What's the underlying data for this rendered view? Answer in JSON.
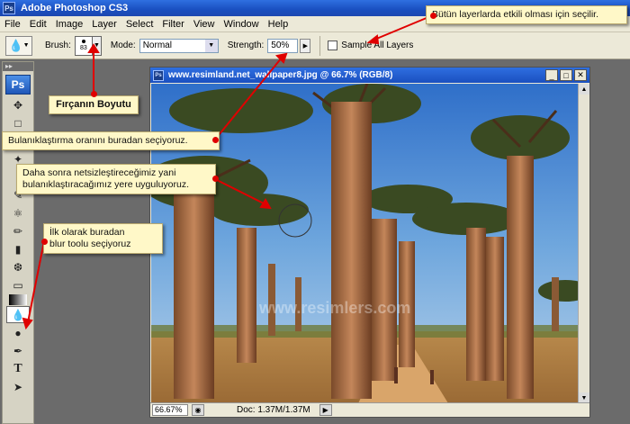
{
  "app": {
    "title": "Adobe Photoshop CS3",
    "logo_letters": "Ps"
  },
  "menu": [
    "File",
    "Edit",
    "Image",
    "Layer",
    "Select",
    "Filter",
    "View",
    "Window",
    "Help"
  ],
  "options": {
    "brush_label": "Brush:",
    "brush_size": "83",
    "mode_label": "Mode:",
    "mode_value": "Normal",
    "strength_label": "Strength:",
    "strength_value": "50%",
    "sample_all_layers_label": "Sample All Layers"
  },
  "document": {
    "title": "www.resimland.net_wallpaper8.jpg @ 66.7% (RGB/8)",
    "zoom": "66.67%",
    "doc_size": "Doc: 1.37M/1.37M",
    "watermark": "www.resimlers.com"
  },
  "callouts": {
    "sample_all": "Bütün layerlarda etkili olması için seçilir.",
    "brush_size": "Fırçanın Boyutu",
    "strength": "Bulanıklaştırma oranını buradan seçiyoruz.",
    "apply_line1": "Daha sonra netsizleştireceğimiz yani",
    "apply_line2": "bulanıklaştıracağımız yere uyguluyoruz.",
    "tool_line1": "İlk olarak buradan",
    "tool_line2": "blur toolu seçiyoruz"
  },
  "colors": {
    "callout_bg": "#fff8c8",
    "marker": "#e00000",
    "titlebar": "#1a4fc0"
  },
  "tools": [
    "move-icon",
    "marquee-icon",
    "lasso-icon",
    "magic-wand-icon",
    "crop-icon",
    "slice-icon",
    "healing-icon",
    "brush-icon",
    "stamp-icon",
    "history-brush-icon",
    "eraser-icon",
    "gradient-icon",
    "blur-icon",
    "dodge-icon",
    "pen-icon",
    "type-icon",
    "path-select-icon"
  ]
}
